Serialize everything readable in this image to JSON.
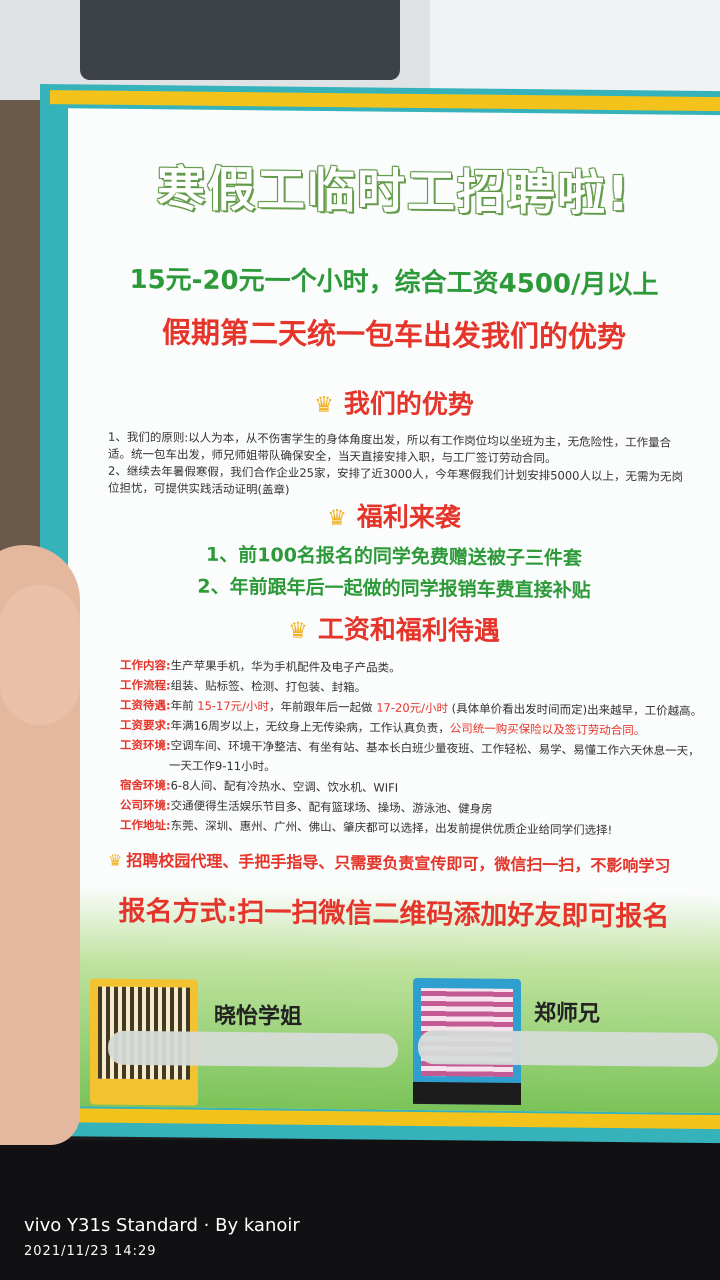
{
  "flyer": {
    "title": "寒假工临时工招聘啦!",
    "subtitle_wage": "15元-20元一个小时，综合工资4500/月以上",
    "subtitle_departure": "假期第二天统一包车出发我们的优势",
    "section_advantages": "我们的优势",
    "advantage_1": "1、我们的原则:以人为本，从不伤害学生的身体角度出发，所以有工作岗位均以坐班为主，无危险性，工作量合适。统一包车出发，师兄师姐带队确保安全，当天直接安排入职，与工厂签订劳动合同。",
    "advantage_2": "2、继续去年暑假寒假，我们合作企业25家，安排了近3000人，今年寒假我们计划安排5000人以上，无需为无岗位担忧，可提供实践活动证明(盖章)",
    "section_benefits": "福利来袭",
    "benefit_1": "1、前100名报名的同学免费赠送被子三件套",
    "benefit_2": "2、年前跟年后一起做的同学报销车费直接补贴",
    "section_wages": "工资和福利待遇",
    "rows": [
      {
        "label": "工作内容:",
        "text": "生产苹果手机，华为手机配件及电子产品类。"
      },
      {
        "label": "工作流程:",
        "text": "组装、贴标签、检测、打包装、封箱。"
      },
      {
        "label": "工资待遇:",
        "pre": "年前 ",
        "red1": "15-17元/小时",
        "mid": "，年前跟年后一起做 ",
        "red2": "17-20元/小时",
        "post": " (具体单价看出发时间而定)出来越早，工价越高。"
      },
      {
        "label": "工资要求:",
        "text": "年满16周岁以上，无纹身上无传染病，工作认真负责，",
        "red": "公司统一购买保险以及签订劳动合同。"
      },
      {
        "label": "工资环境:",
        "text": "空调车间、环境干净整洁、有坐有站、基本长白班少量夜班、工作轻松、易学、易懂工作六天休息一天，",
        "cont": "一天工作9-11小时。"
      },
      {
        "label": "宿舍环境:",
        "text": "6-8人间、配有冷热水、空调、饮水机、WIFI"
      },
      {
        "label": "公司环境:",
        "text": "交通便得生活娱乐节目多、配有篮球场、操场、游泳池、健身房"
      },
      {
        "label": "工作地址:",
        "text": "东莞、深圳、惠州、广州、佛山、肇庆都可以选择，出发前提供优质企业给同学们选择!"
      }
    ],
    "agent_line": "招聘校园代理、手把手指导、只需要负责宣传即可，微信扫一扫，不影响学习",
    "signup": "报名方式:扫一扫微信二维码添加好友即可报名",
    "contact_1": "晓怡学姐",
    "contact_2": "郑师兄",
    "icons": {
      "crown": "crown-icon",
      "qr": "qr-code-icon"
    }
  },
  "watermark": {
    "device": "vivo Y31s Standard · By kanoir",
    "datetime": "2021/11/23 14:29"
  },
  "colors": {
    "teal": "#36b3ba",
    "yellow": "#f3c31b",
    "red": "#e5352b",
    "green": "#2d9a3a"
  }
}
